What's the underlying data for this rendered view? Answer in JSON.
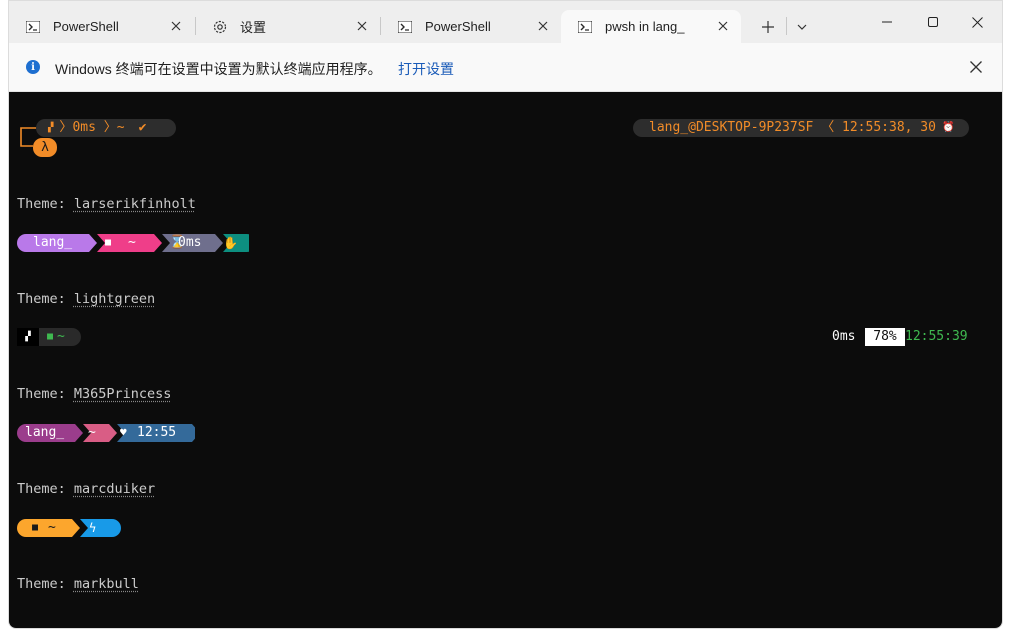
{
  "tabs": [
    {
      "title": "PowerShell",
      "icon": "powershell-icon"
    },
    {
      "title": "设置",
      "icon": "gear-icon"
    },
    {
      "title": "PowerShell",
      "icon": "powershell-icon"
    },
    {
      "title": "pwsh in lang_",
      "icon": "powershell-icon"
    }
  ],
  "infobar": {
    "message": "Windows 终端可在设置中设置为默认终端应用程序。",
    "link": "打开设置"
  },
  "terminal": {
    "prompt1": {
      "duration": "0ms",
      "path": "~",
      "check": "✔",
      "lambda": "λ",
      "right_user": "lang_@DESKTOP-9P237SF",
      "right_time": "12:55:38, 30"
    },
    "theme_label": "Theme: ",
    "themes": [
      {
        "name": "larserikfinholt",
        "user": "lang_",
        "path": "~",
        "duration": "0ms"
      },
      {
        "name": "lightgreen",
        "path": "~",
        "duration": "0ms",
        "battery": "78%",
        "time": "12:55:39"
      },
      {
        "name": "M365Princess",
        "user": "lang_",
        "path": "~",
        "time": "12:55"
      },
      {
        "name": "marcduiker",
        "path": "~"
      },
      {
        "name": "markbull"
      }
    ]
  },
  "colors": {
    "terminal_bg": "#0c0c0c",
    "orange": "#f28c28",
    "lars_purple": "#b979e9",
    "lars_pink": "#ef3e89",
    "lars_gray": "#6f6f8d",
    "lars_teal": "#0d8f80",
    "green": "#3fb950",
    "princess_magenta": "#9b3d8c",
    "princess_pink": "#d95d85",
    "princess_blue": "#346a9a",
    "marc_orange": "#fca62d",
    "marc_blue": "#189ae8"
  }
}
